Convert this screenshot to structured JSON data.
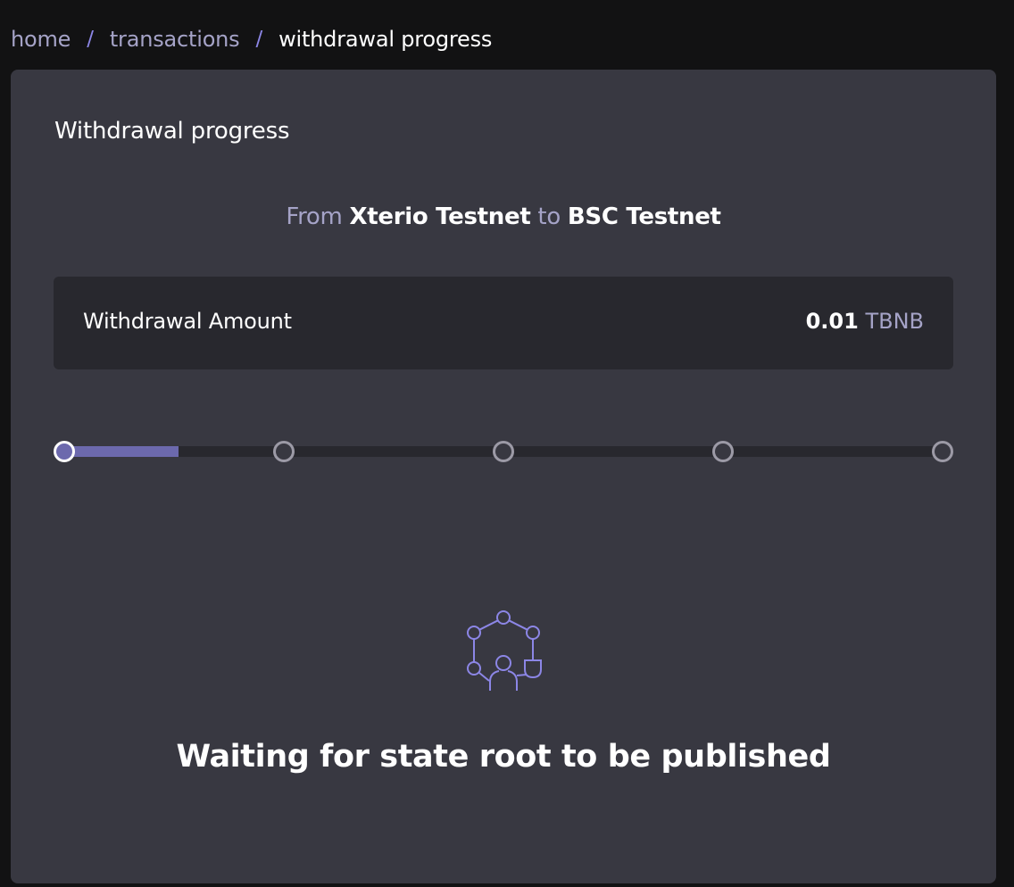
{
  "breadcrumb": {
    "items": [
      "home",
      "transactions"
    ],
    "separator": "/",
    "current": "withdrawal progress"
  },
  "card": {
    "title": "Withdrawal progress"
  },
  "route": {
    "from_label": "From",
    "from_network": "Xterio Testnet",
    "to_label": "to",
    "to_network": "BSC Testnet"
  },
  "amount": {
    "label": "Withdrawal Amount",
    "value": "0.01",
    "unit": "TBNB"
  },
  "progress": {
    "steps_total": 5,
    "current_step": 1,
    "fill_fraction": 0.13
  },
  "status": {
    "icon": "network-people-icon",
    "message": "Waiting for state root to be published"
  },
  "colors": {
    "background": "#121213",
    "card": "#383841",
    "panel": "#28282e",
    "accent": "#6c69ad",
    "muted_text": "#a5a3c7",
    "separator": "#8c86e6"
  }
}
